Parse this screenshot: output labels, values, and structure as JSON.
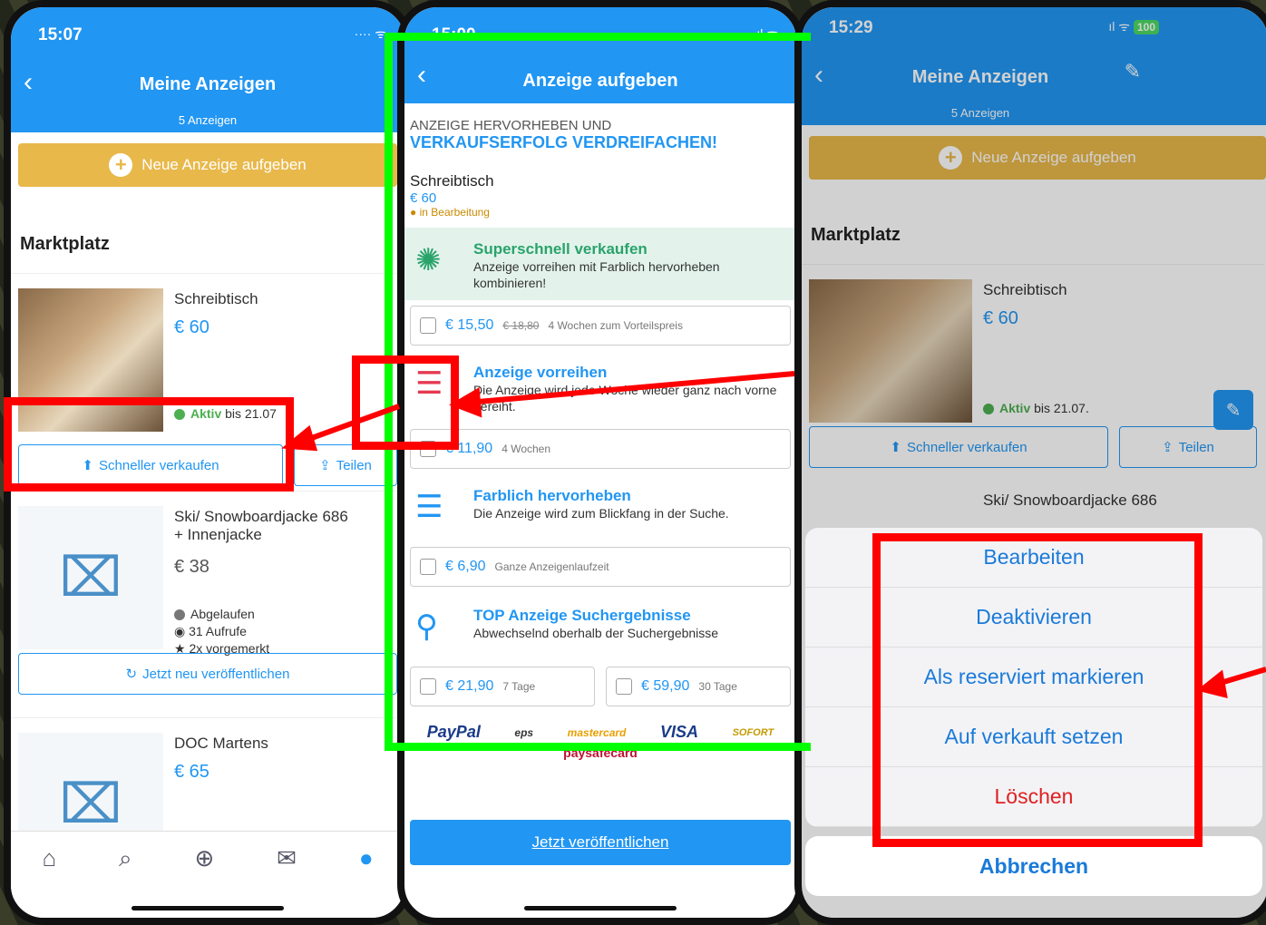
{
  "left": {
    "time": "15:07",
    "title": "Meine Anzeigen",
    "subtitle": "5 Anzeigen",
    "new_ad": "Neue Anzeige aufgeben",
    "section": "Marktplatz",
    "listing1": {
      "name": "Schreibtisch",
      "price": "€ 60",
      "status_word": "Aktiv",
      "status_rest": "bis 21.07",
      "btn_fast": "Schneller verkaufen",
      "btn_share": "Teilen"
    },
    "listing2": {
      "name_l1": "Ski/ Snowboardjacke 686",
      "name_l2": "+ Innenjacke",
      "price": "€ 38",
      "status": "Abgelaufen",
      "views": "31 Aufrufe",
      "saved": "2x vorgemerkt",
      "btn": "Jetzt neu veröffentlichen"
    },
    "listing3": {
      "name": "DOC Martens",
      "price": "€ 65"
    }
  },
  "middle": {
    "time": "15:00",
    "title": "Anzeige aufgeben",
    "note_l1": "ANZEIGE HERVORHEBEN UND",
    "note_l2": "VERKAUFSERFOLG VERDREIFACHEN!",
    "product": {
      "name": "Schreibtisch",
      "price": "€ 60",
      "status": "in Bearbeitung"
    },
    "promo1": {
      "title": "Superschnell verkaufen",
      "desc": "Anzeige vorreihen mit Farblich hervorheben kombinieren!",
      "price": "€ 15,50",
      "old": "€ 18,80",
      "term": "4 Wochen zum Vorteilspreis"
    },
    "promo2": {
      "title": "Anzeige vorreihen",
      "desc": "Die Anzeige wird jede Woche wieder ganz nach vorne gereiht.",
      "price": "€ 11,90",
      "term": "4 Wochen"
    },
    "promo3": {
      "title": "Farblich hervorheben",
      "desc": "Die Anzeige wird zum Blickfang in der Suche.",
      "price": "€ 6,90",
      "term": "Ganze Anzeigenlaufzeit"
    },
    "promo4": {
      "title": "TOP Anzeige Suchergebnisse",
      "desc": "Abwechselnd oberhalb der Suchergebnisse",
      "price_a": "€ 21,90",
      "term_a": "7 Tage",
      "price_b": "€ 59,90",
      "term_b": "30 Tage"
    },
    "payments": [
      "PayPal",
      "eps",
      "mastercard",
      "VISA",
      "SOFORT"
    ],
    "paysafe": "paysafecard",
    "publish": "Jetzt veröffentlichen"
  },
  "right": {
    "time": "15:29",
    "battery": "100",
    "title": "Meine Anzeigen",
    "subtitle": "5 Anzeigen",
    "new_ad": "Neue Anzeige aufgeben",
    "section": "Marktplatz",
    "listing1": {
      "name": "Schreibtisch",
      "price": "€ 60",
      "status_word": "Aktiv",
      "status_rest": "bis 21.07.",
      "btn_fast": "Schneller verkaufen",
      "btn_share": "Teilen"
    },
    "listing2_name": "Ski/ Snowboardjacke 686",
    "actions": [
      "Bearbeiten",
      "Deaktivieren",
      "Als reserviert markieren",
      "Auf verkauft setzen",
      "Löschen"
    ],
    "cancel": "Abbrechen"
  }
}
